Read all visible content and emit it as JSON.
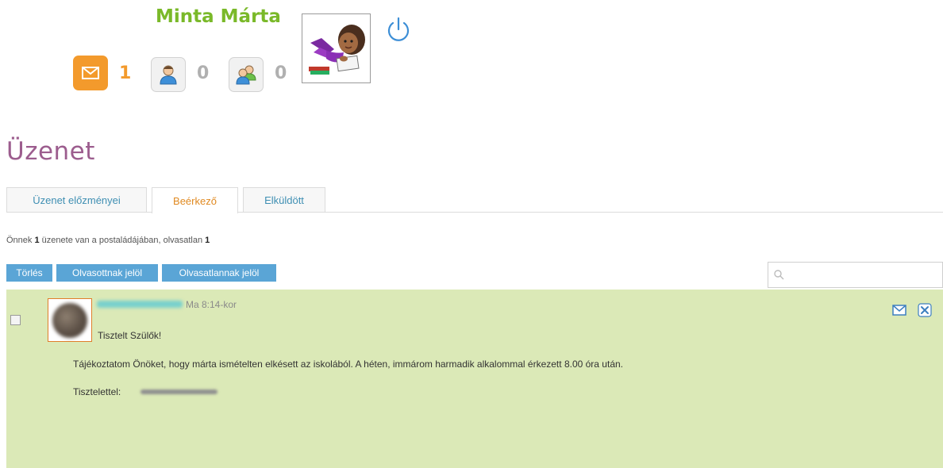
{
  "header": {
    "user_name": "Minta Márta",
    "counters": [
      {
        "icon": "envelope-icon",
        "count": "1",
        "color": "#f39a2c"
      },
      {
        "icon": "person-icon",
        "count": "0",
        "color": "#b0b0b0"
      },
      {
        "icon": "people-icon",
        "count": "0",
        "color": "#b0b0b0"
      }
    ],
    "avatar_icon": "girl-reading-avatar",
    "power_icon": "power-icon"
  },
  "page": {
    "title": "Üzenet",
    "tabs": [
      {
        "label": "Üzenet előzményei",
        "active": false
      },
      {
        "label": "Beérkező",
        "active": true
      },
      {
        "label": "Elküldött",
        "active": false
      }
    ],
    "info": {
      "prefix": "Önnek",
      "total": "1",
      "middle": "üzenete van a postaládájában, olvasatlan",
      "unread": "1"
    },
    "toolbar": [
      {
        "label": "Törlés"
      },
      {
        "label": "Olvasottnak jelöl"
      },
      {
        "label": "Olvasatlannak jelöl"
      }
    ],
    "search": {
      "placeholder": "",
      "value": ""
    }
  },
  "messages": [
    {
      "time": "Ma  8:14-kor",
      "greeting": "Tisztelt Szülők!",
      "body": "Tájékoztatom Önöket, hogy márta ismételten elkésett az iskolából. A héten, immárom harmadik alkalommal érkezett 8.00 óra után.",
      "signature_label": "Tisztelettel:",
      "actions": [
        "reply-envelope-icon",
        "delete-icon"
      ]
    }
  ],
  "colors": {
    "accent_orange": "#f39a2c",
    "user_name_green": "#7ab929",
    "title_purple": "#9c5d8e",
    "button_blue": "#5aa5d6",
    "message_background": "#dbe9b7"
  }
}
